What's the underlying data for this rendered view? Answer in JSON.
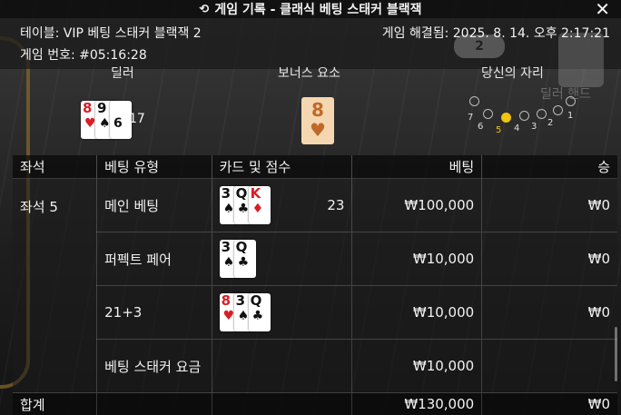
{
  "window": {
    "title": "게임 기록 - 클래식 베팅 스태커 블랙잭",
    "close_symbol": "✕"
  },
  "info": {
    "table_label": "테이블: VIP 베팅 스태커 블랙잭 2",
    "game_number_label": "게임 번호: #05:16:28",
    "resolved_label": "게임 해결됨: 2025. 8. 14. 오후 2:17:21",
    "badge_value": "2"
  },
  "section": {
    "dealer_label": "딜러",
    "bonus_label": "보너스 요소",
    "position_label": "당신의 자리",
    "dealer_hand_label": "딜러 핸드",
    "dealer_score": "17",
    "dealer_cards": [
      {
        "rank": "8",
        "suit": "♥",
        "color": "red"
      },
      {
        "rank": "9",
        "suit": "♠",
        "color": "black"
      },
      {
        "rank": "",
        "suit": "6",
        "color": "black"
      }
    ],
    "bonus_card": {
      "rank": "8",
      "suit": "♥"
    },
    "seats": [
      {
        "num": "7",
        "active": false
      },
      {
        "num": "6",
        "active": false
      },
      {
        "num": "5",
        "active": true
      },
      {
        "num": "4",
        "active": false
      },
      {
        "num": "3",
        "active": false
      },
      {
        "num": "2",
        "active": false
      },
      {
        "num": "1",
        "active": false
      }
    ]
  },
  "table": {
    "headers": {
      "seat": "좌석",
      "bet_type": "베팅 유형",
      "cards": "카드 및 점수",
      "bet": "베팅",
      "win": "승"
    },
    "seat_label": "좌석 5",
    "rows": [
      {
        "bet_type": "메인 베팅",
        "cards": [
          {
            "rank": "3",
            "suit": "♠",
            "color": "black"
          },
          {
            "rank": "Q",
            "suit": "♣",
            "color": "black"
          },
          {
            "rank": "K",
            "suit": "♦",
            "color": "red"
          }
        ],
        "score": "23",
        "bet": "₩100,000",
        "win": "₩0"
      },
      {
        "bet_type": "퍼펙트 페어",
        "cards": [
          {
            "rank": "3",
            "suit": "♠",
            "color": "black"
          },
          {
            "rank": "Q",
            "suit": "♣",
            "color": "black"
          }
        ],
        "score": "",
        "bet": "₩10,000",
        "win": "₩0"
      },
      {
        "bet_type": "21+3",
        "cards": [
          {
            "rank": "8",
            "suit": "♥",
            "color": "red"
          },
          {
            "rank": "3",
            "suit": "♠",
            "color": "black"
          },
          {
            "rank": "Q",
            "suit": "♣",
            "color": "black"
          }
        ],
        "score": "",
        "bet": "₩10,000",
        "win": "₩0"
      },
      {
        "bet_type": "베팅 스태커 요금",
        "cards": [],
        "score": "",
        "bet": "₩10,000",
        "win": ""
      }
    ],
    "total": {
      "label": "합계",
      "bet": "₩130,000",
      "win": "₩0"
    }
  },
  "colors": {
    "accent_active_seat": "#f1c40f",
    "card_red": "#d81f26",
    "bonus_card_bg": "#f4d7b0"
  }
}
